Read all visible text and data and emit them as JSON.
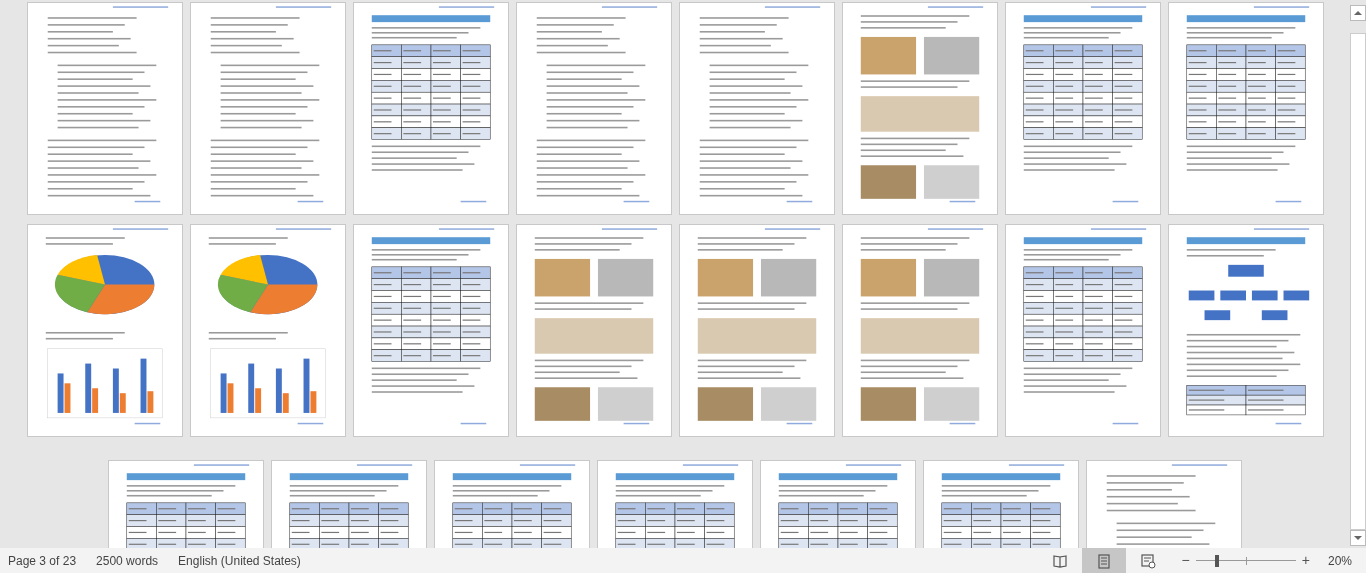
{
  "document_pages": [
    {
      "kind": "text"
    },
    {
      "kind": "text"
    },
    {
      "kind": "table"
    },
    {
      "kind": "text"
    },
    {
      "kind": "text"
    },
    {
      "kind": "images"
    },
    {
      "kind": "table"
    },
    {
      "kind": "table"
    },
    {
      "kind": "chart"
    },
    {
      "kind": "chart"
    },
    {
      "kind": "table"
    },
    {
      "kind": "images"
    },
    {
      "kind": "images"
    },
    {
      "kind": "images"
    },
    {
      "kind": "table"
    },
    {
      "kind": "diagram"
    },
    {
      "kind": "table"
    },
    {
      "kind": "table"
    },
    {
      "kind": "table"
    },
    {
      "kind": "table"
    },
    {
      "kind": "table"
    },
    {
      "kind": "table"
    },
    {
      "kind": "text"
    }
  ],
  "status_bar": {
    "page": "Page 3 of 23",
    "words": "2500 words",
    "language": "English (United States)",
    "views": [
      {
        "kind": "read",
        "selected": false
      },
      {
        "kind": "print",
        "selected": true
      },
      {
        "kind": "web",
        "selected": false
      }
    ],
    "zoom": {
      "minus": "−",
      "plus": "+",
      "level": 0.2,
      "reading": "20%"
    }
  }
}
